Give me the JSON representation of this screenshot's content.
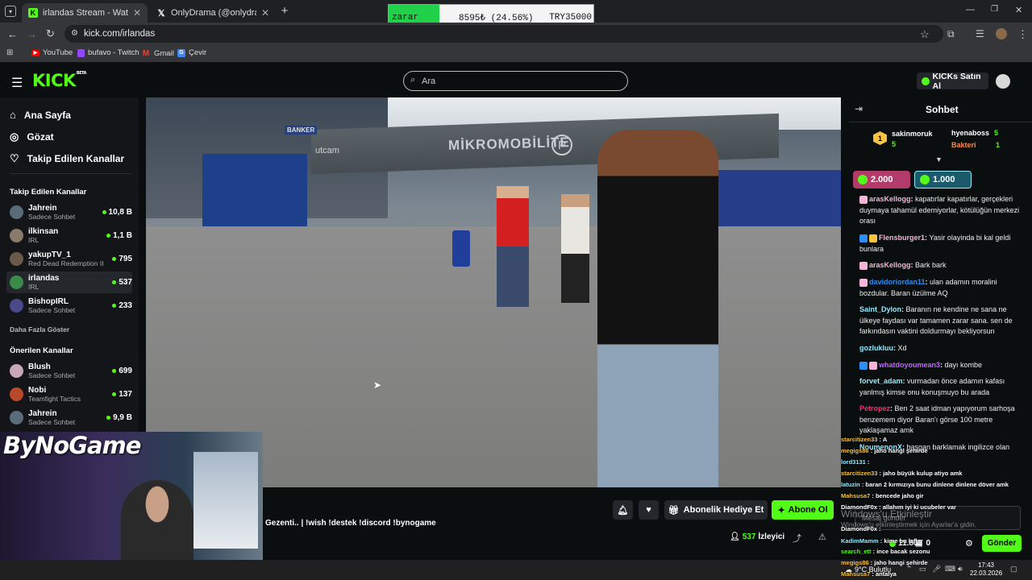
{
  "browser": {
    "tabs": [
      {
        "title": "irlandas Stream - Watch Live",
        "favicon": "kick-icon",
        "active": true
      },
      {
        "title": "OnlyDrama (@onlydramaX) / X",
        "favicon": "x-icon",
        "active": false
      }
    ],
    "new_tab": "+",
    "url": "kick.com/irlandas",
    "bookmarks": [
      "YouTube",
      "bufavo - Twitch",
      "Gmail",
      "Çevir"
    ]
  },
  "ticker": {
    "label": "zarar",
    "amount": "8595₺ (24.56%)",
    "target": "TRY35000"
  },
  "header": {
    "logo": "KICK",
    "logo_badge": "BETA",
    "search_placeholder": "Ara",
    "buy_kicks": "KICKs Satın Al"
  },
  "sidebar": {
    "nav": [
      "Ana Sayfa",
      "Gözat",
      "Takip Edilen Kanallar"
    ],
    "followed_title": "Takip Edilen Kanallar",
    "followed": [
      {
        "name": "Jahrein",
        "game": "Sadece Sohbet",
        "viewers": "10,8 B",
        "color": "#5a6b7a"
      },
      {
        "name": "ilkinsan",
        "game": "IRL",
        "viewers": "1,1 B",
        "color": "#8a7a6a"
      },
      {
        "name": "yakupTV_1",
        "game": "Red Dead Redemption II",
        "viewers": "795",
        "color": "#6a5a4a"
      },
      {
        "name": "irlandas",
        "game": "IRL",
        "viewers": "537",
        "color": "#3a8a4a"
      },
      {
        "name": "BishopIRL",
        "game": "Sadece Sohbet",
        "viewers": "233",
        "color": "#4a4a8a"
      }
    ],
    "show_more": "Daha Fazla Göster",
    "recommended_title": "Önerilen Kanallar",
    "recommended": [
      {
        "name": "Blush",
        "game": "Sadece Sohbet",
        "viewers": "699",
        "color": "#c8a8b8"
      },
      {
        "name": "Nobi",
        "game": "Teamfight Tactics",
        "viewers": "137",
        "color": "#b84a2a"
      },
      {
        "name": "Jahrein",
        "game": "Sadece Sohbet",
        "viewers": "9,9 B",
        "color": "#5a6b7a"
      }
    ]
  },
  "video": {
    "sign_text": "MİKROMOBİLİTE",
    "sign_letter": "P",
    "left_sign": "utcam",
    "banker": "BANKER"
  },
  "stream": {
    "title": "Gezenti.. | !wish !destek !discord !bynogame",
    "gift_sub": "Abonelik Hediye Et",
    "subscribe": "Abone Ol",
    "viewers_count": "537",
    "viewers_label": "İzleyici"
  },
  "facecam": {
    "logo": "ByNoGame"
  },
  "chat": {
    "title": "Sohbet",
    "leaders": [
      {
        "rank": "1",
        "name": "sakinmoruk",
        "count": "5"
      },
      {
        "name": "hyenaboss",
        "count": "5"
      },
      {
        "name": "Bakteri",
        "count": "1"
      }
    ],
    "pins": [
      "2.000",
      "1.000"
    ],
    "messages": [
      {
        "user": "arasKellogg",
        "text": "kapatırlar kapatırlar, gerçekleri duymaya tahamül edemiyorlar, kötülüğün merkezi orası",
        "color": "#f4b5d6"
      },
      {
        "user": "Flensburger1",
        "text": "Yasir olayinda bi kal geldi bunlara",
        "color": "#f4b5d6"
      },
      {
        "user": "arasKellogg",
        "text": "Bark bark",
        "color": "#f4b5d6"
      },
      {
        "user": "davidoriordan11",
        "text": "ulan adamın moralini bozdular. Baran üzülme AQ",
        "color": "#2f8df4"
      },
      {
        "user": "Saint_Dylon",
        "text": "Baranın ne kendine ne sana ne ülkeye faydası var tamamen zarar sana. sen de farkındasın vaktini doldurmayı bekliyorsun",
        "color": "#93ebff"
      },
      {
        "user": "gozlukluu",
        "text": "Xd",
        "color": "#93ebff"
      },
      {
        "user": "whatdoyoumean3",
        "text": "dayı kombe",
        "color": "#bc66ff"
      },
      {
        "user": "forvet_adam",
        "text": "vurmadan önce adamın kafası yanlmış kimse onu konuşmuyo bu arada",
        "color": "#93ebff"
      },
      {
        "user": "Petropez",
        "text": "Ben 2 saat idman yapıyorum sarhoşa benzemem diyor Baran'ı görse 100 metre yaklaşamaz amk",
        "color": "#ff2a6d"
      },
      {
        "user": "NoumenonX",
        "text": "başgan barklamak ingilizce olan",
        "color": "#93ebff"
      }
    ],
    "input_placeholder": "Mesaj gönder",
    "kicks_balance": "11.800",
    "points": "0",
    "send": "Gönder"
  },
  "overlay_chat": [
    {
      "user": "starcitizen33",
      "text": "A"
    },
    {
      "user": "megigs86",
      "text": "jaho hangi şehirde"
    },
    {
      "user": "lord3131",
      "text": ""
    },
    {
      "user": "starcitizen33",
      "text": "jaho büyük kulup atiyo amk"
    },
    {
      "user": "latuzin",
      "text": "baran 2 kırmızıya bunu dinlene dinlene döver amk"
    },
    {
      "user": "Mahsusa7",
      "text": "bencede jaho gir"
    },
    {
      "user": "DiamondF0x",
      "text": "allahım iyi ki ucubeler var"
    },
    {
      "user": "DiamondF0x",
      "text": ""
    },
    {
      "user": "KadimMamm",
      "text": "kime bu laflar"
    },
    {
      "user": "search_ett",
      "text": "ince bacak sezonu"
    },
    {
      "user": "megigs86",
      "text": "jaho hangi şehirde"
    },
    {
      "user": "Mahsusa7",
      "text": "antalya"
    }
  ],
  "windows_watermark": {
    "line1": "Windows'u Etkinleştir",
    "line2": "Windows'u etkinleştirmek için Ayarlar'a gidin."
  },
  "taskbar": {
    "weather": "9°C Bulutlu",
    "time": "17:43",
    "date": "22.03.2026"
  },
  "colors": {
    "accent": "#53fc18",
    "background": "#0b0e0f",
    "sidebar": "#141518"
  }
}
